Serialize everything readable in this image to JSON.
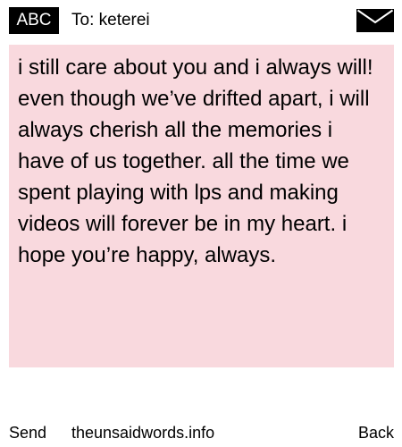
{
  "header": {
    "badge": "ABC",
    "to_label": "To: keterei",
    "mail_icon": "envelope-icon"
  },
  "message": {
    "text": "i still care about you and i always will! even though we’ve drifted apart, i will always cherish all the memories i have of us together. all the time we spent playing with lps and making videos will forever be in my heart. i hope you’re happy, always.",
    "background_color": "#f9d9de"
  },
  "footer": {
    "send_label": "Send",
    "site_label": "theunsaidwords.info",
    "back_label": "Back"
  }
}
